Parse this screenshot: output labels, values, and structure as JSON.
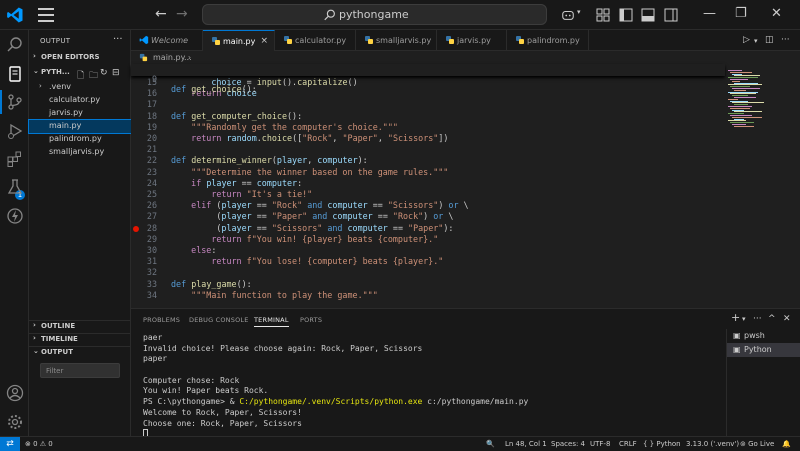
{
  "titlebar": {
    "search_text": "pythongame",
    "nav_back": "←",
    "nav_forward": "→",
    "minimize": "—",
    "restore": "❐",
    "close": "✕"
  },
  "activity": {
    "extensions_badge": "1"
  },
  "sidebar": {
    "header": "OUTPUT",
    "more": "···",
    "open_editors": "OPEN EDITORS",
    "folder": "PYTH...",
    "tree": [
      {
        "label": ".venv",
        "kind": "folder"
      },
      {
        "label": "calculator.py"
      },
      {
        "label": "jarvis.py"
      },
      {
        "label": "main.py",
        "selected": true
      },
      {
        "label": "palindrom.py"
      },
      {
        "label": "smalljarvis.py"
      }
    ],
    "outline": "OUTLINE",
    "timeline": "TIMELINE",
    "output": "OUTPUT",
    "filter_placeholder": "Filter"
  },
  "tabs": [
    {
      "label": "Welcome",
      "kind": "welcome"
    },
    {
      "label": "main.py",
      "active": true,
      "close": "×"
    },
    {
      "label": "calculator.py"
    },
    {
      "label": "smalljarvis.py"
    },
    {
      "label": "jarvis.py"
    },
    {
      "label": "palindrom.py"
    }
  ],
  "tab_actions": {
    "run": "▷",
    "split": "▾",
    "layout": "◫",
    "more": "···"
  },
  "breadcrumb": {
    "file": "main.py",
    "sep": "›",
    "symbol": "..."
  },
  "editor": {
    "sticky": {
      "num": "9",
      "text": "def get_choice():"
    },
    "lines": [
      {
        "num": "15",
        "text": "        choice = input().capitalize()"
      },
      {
        "num": "16",
        "text": "    return choice"
      },
      {
        "num": "17",
        "text": ""
      },
      {
        "num": "18",
        "text": "def get_computer_choice():"
      },
      {
        "num": "19",
        "text": "    \"\"\"Randomly get the computer's choice.\"\"\""
      },
      {
        "num": "20",
        "text": "    return random.choice([\"Rock\", \"Paper\", \"Scissors\"])"
      },
      {
        "num": "21",
        "text": ""
      },
      {
        "num": "22",
        "text": "def determine_winner(player, computer):"
      },
      {
        "num": "23",
        "text": "    \"\"\"Determine the winner based on the game rules.\"\"\""
      },
      {
        "num": "24",
        "text": "    if player == computer:"
      },
      {
        "num": "25",
        "text": "        return \"It's a tie!\""
      },
      {
        "num": "26",
        "text": "    elif (player == \"Rock\" and computer == \"Scissors\") or \\"
      },
      {
        "num": "27",
        "text": "         (player == \"Paper\" and computer == \"Rock\") or \\"
      },
      {
        "num": "28",
        "text": "         (player == \"Scissors\" and computer == \"Paper\"):",
        "breakpoint": true
      },
      {
        "num": "29",
        "text": "        return f\"You win! {player} beats {computer}.\""
      },
      {
        "num": "30",
        "text": "    else:"
      },
      {
        "num": "31",
        "text": "        return f\"You lose! {computer} beats {player}.\""
      },
      {
        "num": "32",
        "text": ""
      },
      {
        "num": "33",
        "text": "def play_game():"
      },
      {
        "num": "34",
        "text": "    \"\"\"Main function to play the game.\"\"\""
      }
    ]
  },
  "panel": {
    "tabs": [
      "PROBLEMS",
      "DEBUG CONSOLE",
      "TERMINAL",
      "PORTS"
    ],
    "active_tab": "TERMINAL",
    "actions": {
      "new": "+",
      "dropdown": "▾",
      "more": "···",
      "maximize": "^",
      "close": "✕"
    },
    "terminal_lines": [
      "paer",
      "Invalid choice! Please choose again: Rock, Paper, Scissors",
      "paper",
      "",
      "Computer chose: Rock",
      "You win! Paper beats Rock.",
      "PS C:\\pythongame> & C:/pythongame/.venv/Scripts/python.exe c:/pythongame/main.py",
      "Welcome to Rock, Paper, Scissors!",
      "Choose one: Rock, Paper, Scissors"
    ],
    "terminals": [
      {
        "label": "pwsh"
      },
      {
        "label": "Python",
        "active": true
      }
    ]
  },
  "statusbar": {
    "errors": "0",
    "warnings": "0",
    "position": "Ln 48, Col 1",
    "spaces": "Spaces: 4",
    "encoding": "UTF-8",
    "eol": "CRLF",
    "language": "Python",
    "interpreter": "3.13.0 ('.venv')",
    "golive": "Go Live"
  },
  "colors": {
    "accent": "#0078d4",
    "background": "#1f1f1f",
    "keyword": "#c586c0",
    "function": "#dcdcaa",
    "string": "#ce9178"
  }
}
